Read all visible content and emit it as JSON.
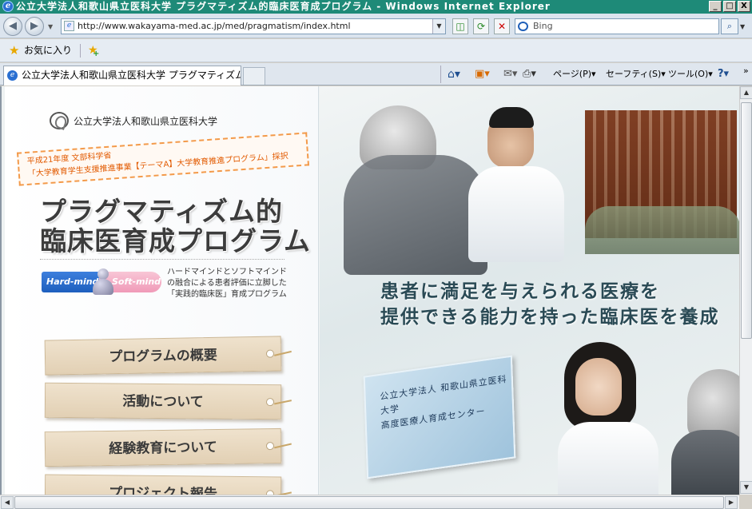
{
  "window": {
    "title": "公立大学法人和歌山県立医科大学 プラグマティズム的臨床医育成プログラム - Windows Internet Explorer",
    "min_label": "_",
    "max_label": "□",
    "close_label": "X"
  },
  "address": {
    "url": "http://www.wakayama-med.ac.jp/med/pragmatism/index.html",
    "search_placeholder": "Bing"
  },
  "favorites": {
    "label": "お気に入り"
  },
  "tabs": [
    {
      "label": "公立大学法人和歌山県立医科大学 プラグマティズム..."
    }
  ],
  "command_bar": {
    "page": "ページ(P)",
    "safety": "セーフティ(S)",
    "tools": "ツール(O)"
  },
  "page": {
    "univ_name": "公立大学法人和歌山県立医科大学",
    "badge_line1": "平成21年度 文部科学省",
    "badge_line2": "「大学教育学生支援推進事業【テーマA】大学教育推進プログラム」採択",
    "title_line1": "プラグマティズム的",
    "title_line2": "臨床医育成プログラム",
    "hard_label": "Hard-mind",
    "soft_label": "Soft-mind",
    "desc_line1": "ハードマインドとソフトマインド",
    "desc_line2": "の融合による患者評価に立脚した",
    "desc_line3": "「実践的臨床医」育成プログラム",
    "menu": [
      {
        "label": "プログラムの概要"
      },
      {
        "label": "活動について"
      },
      {
        "label": "経験教育について"
      },
      {
        "label": "プロジェクト報告"
      }
    ],
    "tagline_line1": "患者に満足を与えられる医療を",
    "tagline_line2": "提供できる能力を持った臨床医を養成",
    "sign_line1": "公立大学法人 和歌山県立医科大学",
    "sign_line2": "高度医療人育成センター"
  },
  "colors": {
    "titlebar": "#1e8a78",
    "badge_orange": "#e25a00",
    "hard_blue": "#1e5fbe",
    "soft_pink": "#f09ab8"
  }
}
